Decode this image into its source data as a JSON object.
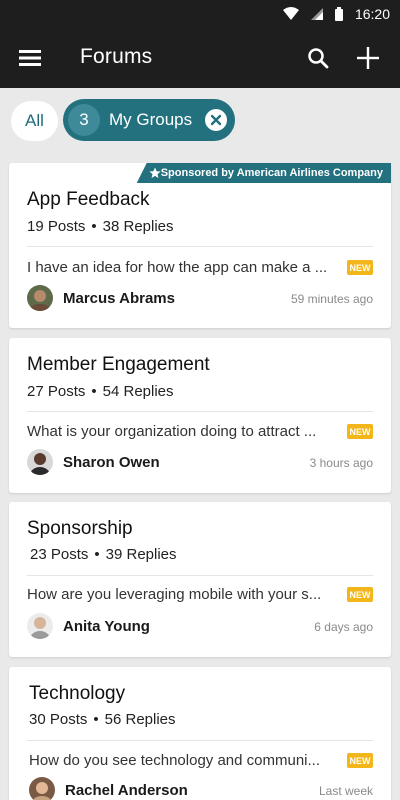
{
  "status_bar": {
    "time": "16:20",
    "icons": [
      "wifi-icon",
      "signal-icon",
      "battery-icon"
    ]
  },
  "app_bar": {
    "title": "Forums",
    "menu_icon": "menu-icon",
    "search_icon": "search-icon",
    "add_icon": "add-icon"
  },
  "filters": {
    "all_label": "All",
    "groups_count": "3",
    "groups_label": "My Groups",
    "clear_icon": "close-icon"
  },
  "colors": {
    "accent": "#23707f",
    "new_badge": "#f2b61b",
    "app_bar": "#1e1e1e"
  },
  "sponsor": {
    "label": "Sponsored by American Airlines Company"
  },
  "forums": [
    {
      "title": "App Feedback",
      "posts": "19 Posts",
      "replies": "38 Replies",
      "preview": "I have an idea for how the app can make a ...",
      "badge": "NEW",
      "author": "Marcus Abrams",
      "time": "59 minutes ago"
    },
    {
      "title": "Member Engagement",
      "posts": "27 Posts",
      "replies": "54 Replies",
      "preview": "What is your organization doing to attract ...",
      "badge": "NEW",
      "author": "Sharon Owen",
      "time": "3 hours ago"
    },
    {
      "title": "Sponsorship",
      "posts": "23 Posts",
      "replies": "39 Replies",
      "preview": "How are you leveraging mobile with your s...",
      "badge": "NEW",
      "author": "Anita Young",
      "time": "6 days ago"
    },
    {
      "title": "Technology",
      "posts": "30 Posts",
      "replies": "56 Replies",
      "preview": "How do you see technology and communi...",
      "badge": "NEW",
      "author": "Rachel Anderson",
      "time": "Last week"
    }
  ]
}
